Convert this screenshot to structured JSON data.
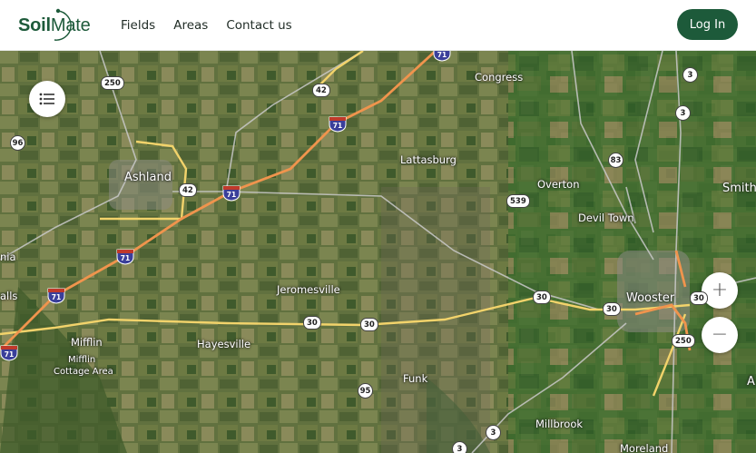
{
  "header": {
    "logo_text_bold": "Soil",
    "logo_text_light": "Mate",
    "nav": [
      {
        "label": "Fields"
      },
      {
        "label": "Areas"
      },
      {
        "label": "Contact us"
      }
    ],
    "login_label": "Log In"
  },
  "map": {
    "controls": {
      "layers_icon": "list-icon",
      "zoom_in_label": "+",
      "zoom_out_label": "−"
    },
    "places": [
      {
        "name": "Congress"
      },
      {
        "name": "Ashland"
      },
      {
        "name": "Lattasburg"
      },
      {
        "name": "Overton"
      },
      {
        "name": "Devil Town"
      },
      {
        "name": "Smith"
      },
      {
        "name": "Jeromesville"
      },
      {
        "name": "Wooster"
      },
      {
        "name": "Mifflin"
      },
      {
        "name": "Hayesville"
      },
      {
        "name": "Mifflin"
      },
      {
        "name": "Cottage Area"
      },
      {
        "name": "Funk"
      },
      {
        "name": "Millbrook"
      },
      {
        "name": "Moreland"
      },
      {
        "name": "nia"
      },
      {
        "name": "alls"
      },
      {
        "name": "A"
      }
    ],
    "shields": [
      {
        "num": "250"
      },
      {
        "num": "42"
      },
      {
        "num": "3"
      },
      {
        "num": "3"
      },
      {
        "num": "96"
      },
      {
        "num": "83"
      },
      {
        "num": "42"
      },
      {
        "num": "539"
      },
      {
        "num": "30"
      },
      {
        "num": "30"
      },
      {
        "num": "30"
      },
      {
        "num": "30"
      },
      {
        "num": "30"
      },
      {
        "num": "250"
      },
      {
        "num": "95"
      },
      {
        "num": "3"
      },
      {
        "num": "3"
      }
    ],
    "interstates": [
      {
        "num": "71"
      },
      {
        "num": "71"
      },
      {
        "num": "71"
      },
      {
        "num": "71"
      },
      {
        "num": "71"
      },
      {
        "num": "71"
      }
    ]
  },
  "colors": {
    "brand": "#1d5a3a",
    "interstate": "#f0944d",
    "us_route": "#f2d36b",
    "local_road": "#c9c9c9"
  }
}
